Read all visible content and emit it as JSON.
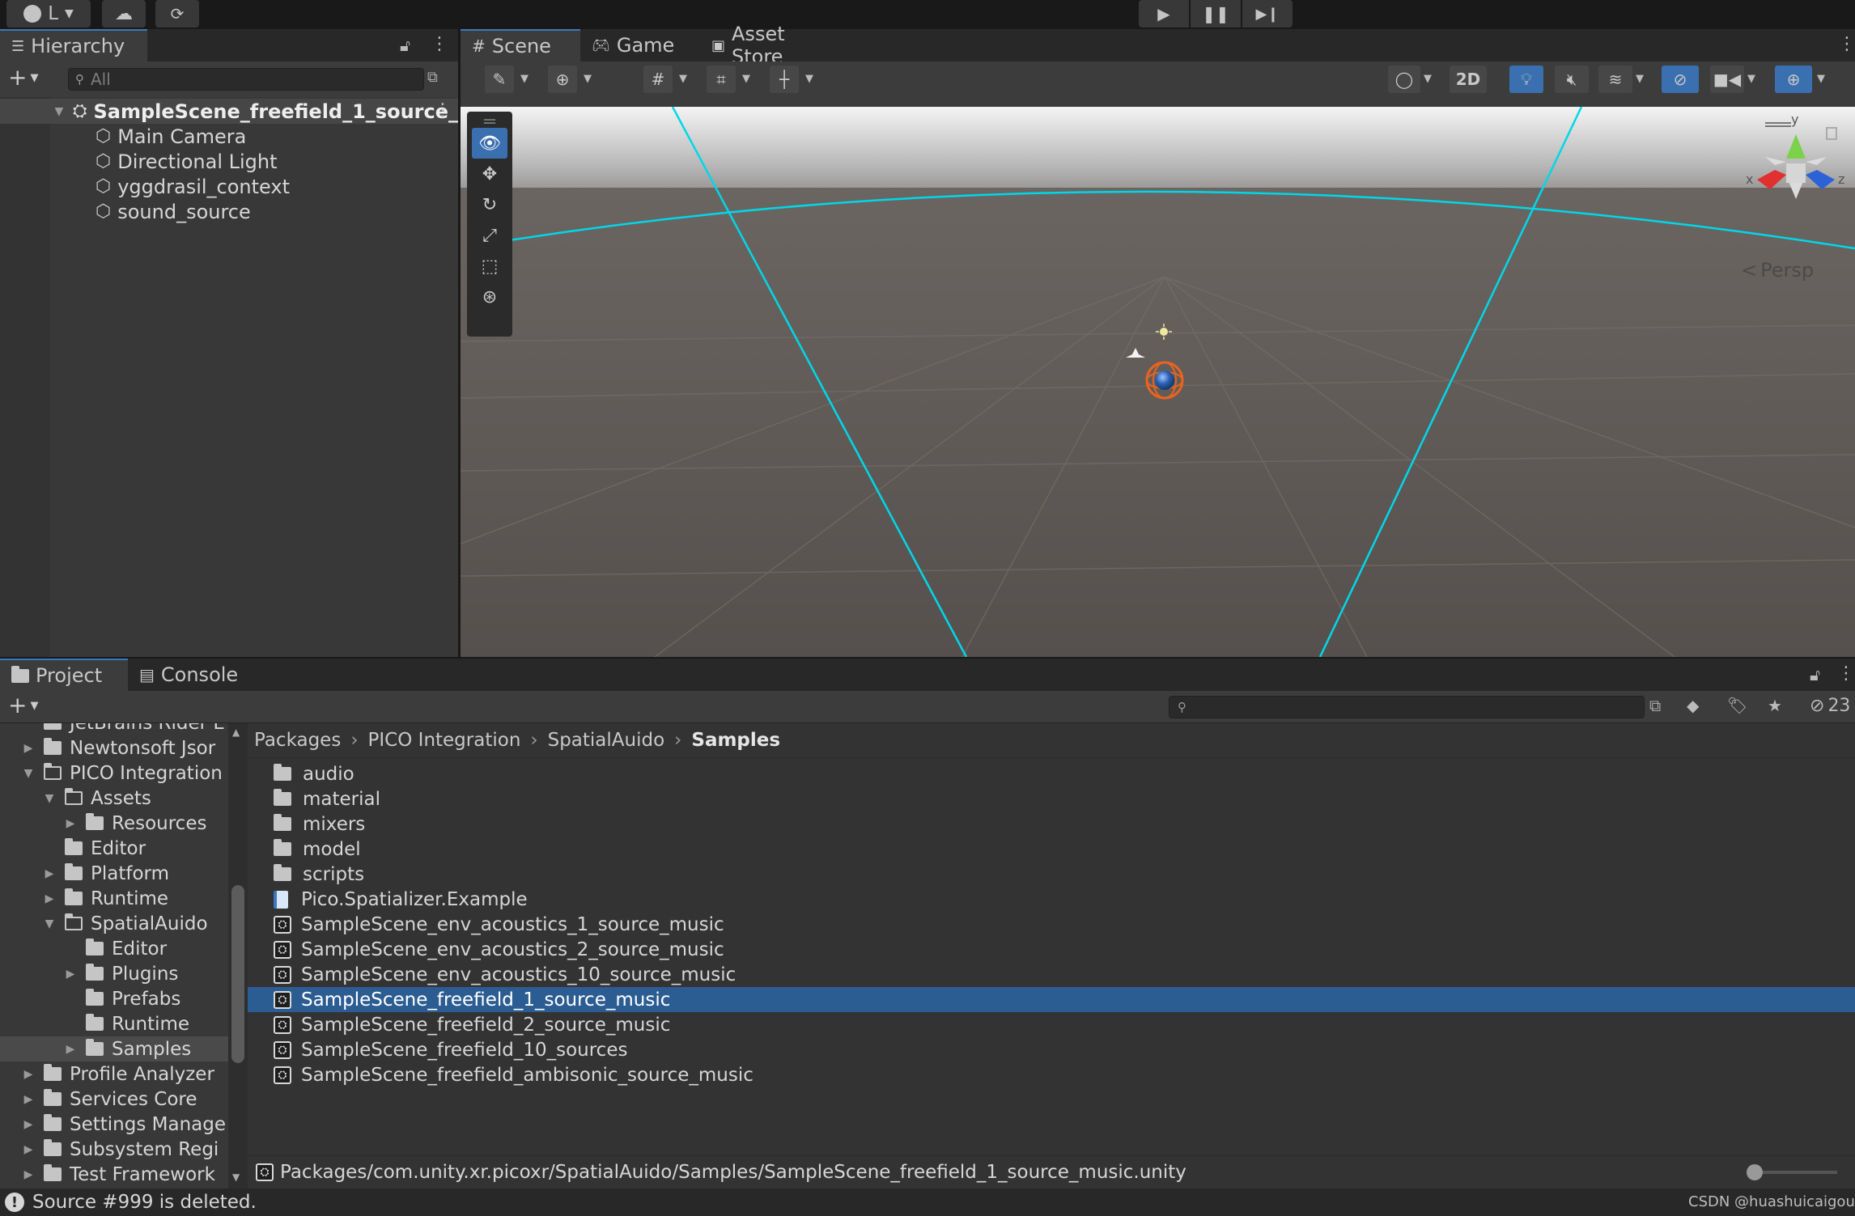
{
  "topbar": {
    "account_label": "L",
    "play_icon": "play-icon",
    "pause_icon": "pause-icon",
    "step_icon": "step-icon"
  },
  "hierarchy": {
    "tab_label": "Hierarchy",
    "search_placeholder": "All",
    "scene_name": "SampleScene_freefield_1_source_",
    "items": [
      "Main Camera",
      "Directional Light",
      "yggdrasil_context",
      "sound_source"
    ]
  },
  "scene_view": {
    "tabs": [
      "Scene",
      "Game",
      "Asset Store"
    ],
    "mode_2d_label": "2D",
    "persp_label": "Persp",
    "axis_labels": {
      "x": "x",
      "y": "y",
      "z": "z"
    }
  },
  "project": {
    "tabs": [
      "Project",
      "Console"
    ],
    "hidden_count": "23",
    "breadcrumb": [
      "Packages",
      "PICO Integration",
      "SpatialAuido",
      "Samples"
    ],
    "tree": [
      {
        "label": "JetBrains Rider E",
        "depth": 0,
        "arrow": "none",
        "open": false
      },
      {
        "label": "Newtonsoft Jsor",
        "depth": 0,
        "arrow": "right",
        "open": false
      },
      {
        "label": "PICO Integration",
        "depth": 0,
        "arrow": "down",
        "open": true
      },
      {
        "label": "Assets",
        "depth": 1,
        "arrow": "down",
        "open": true
      },
      {
        "label": "Resources",
        "depth": 2,
        "arrow": "right",
        "open": false
      },
      {
        "label": "Editor",
        "depth": 1,
        "arrow": "none",
        "open": false
      },
      {
        "label": "Platform",
        "depth": 1,
        "arrow": "right",
        "open": false
      },
      {
        "label": "Runtime",
        "depth": 1,
        "arrow": "right",
        "open": false
      },
      {
        "label": "SpatialAuido",
        "depth": 1,
        "arrow": "down",
        "open": true
      },
      {
        "label": "Editor",
        "depth": 2,
        "arrow": "none",
        "open": false
      },
      {
        "label": "Plugins",
        "depth": 2,
        "arrow": "right",
        "open": false
      },
      {
        "label": "Prefabs",
        "depth": 2,
        "arrow": "none",
        "open": false
      },
      {
        "label": "Runtime",
        "depth": 2,
        "arrow": "none",
        "open": false
      },
      {
        "label": "Samples",
        "depth": 2,
        "arrow": "right",
        "open": false,
        "selected": true
      },
      {
        "label": "Profile Analyzer",
        "depth": 0,
        "arrow": "right",
        "open": false
      },
      {
        "label": "Services Core",
        "depth": 0,
        "arrow": "right",
        "open": false
      },
      {
        "label": "Settings Manage",
        "depth": 0,
        "arrow": "right",
        "open": false
      },
      {
        "label": "Subsystem Regi",
        "depth": 0,
        "arrow": "right",
        "open": false
      },
      {
        "label": "Test Framework",
        "depth": 0,
        "arrow": "right",
        "open": false
      }
    ],
    "files": [
      {
        "name": "audio",
        "kind": "folder"
      },
      {
        "name": "material",
        "kind": "folder"
      },
      {
        "name": "mixers",
        "kind": "folder"
      },
      {
        "name": "model",
        "kind": "folder"
      },
      {
        "name": "scripts",
        "kind": "folder"
      },
      {
        "name": "Pico.Spatializer.Example",
        "kind": "asmdef"
      },
      {
        "name": "SampleScene_env_acoustics_1_source_music",
        "kind": "scene"
      },
      {
        "name": "SampleScene_env_acoustics_2_source_music",
        "kind": "scene"
      },
      {
        "name": "SampleScene_env_acoustics_10_source_music",
        "kind": "scene"
      },
      {
        "name": "SampleScene_freefield_1_source_music",
        "kind": "scene",
        "selected": true
      },
      {
        "name": "SampleScene_freefield_2_source_music",
        "kind": "scene"
      },
      {
        "name": "SampleScene_freefield_10_sources",
        "kind": "scene"
      },
      {
        "name": "SampleScene_freefield_ambisonic_source_music",
        "kind": "scene"
      }
    ],
    "selected_path": "Packages/com.unity.xr.picoxr/SpatialAuido/Samples/SampleScene_freefield_1_source_music.unity"
  },
  "status": {
    "message": "Source #999 is deleted.",
    "watermark": "CSDN @huashuicaigou"
  },
  "colors": {
    "accent": "#2c5d92",
    "horizon_line": "#00d8e8",
    "ground": "#5a5450"
  }
}
